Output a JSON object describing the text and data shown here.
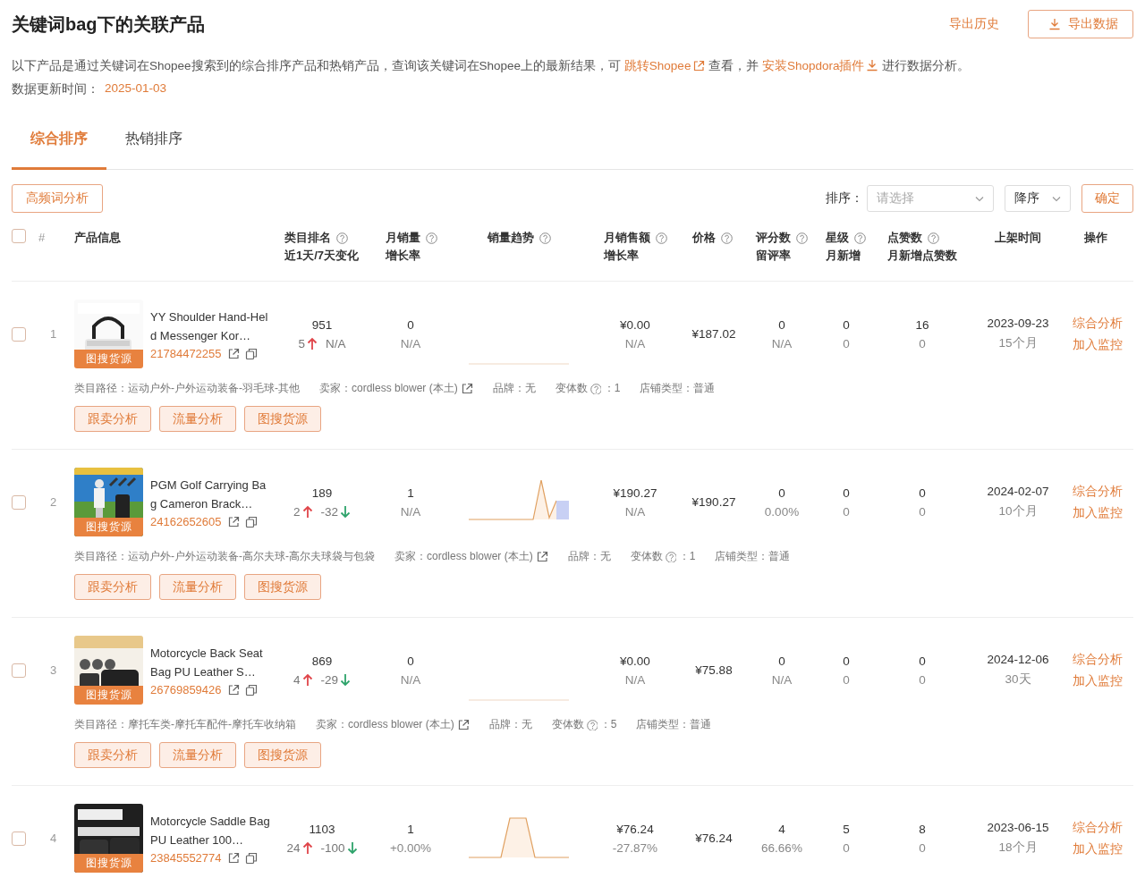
{
  "header": {
    "title": "关键词bag下的关联产品",
    "history_link": "导出历史",
    "export_button": "导出数据"
  },
  "intro": {
    "before": "以下产品是通过关键词在Shopee搜索到的综合排序产品和热销产品，查询该关键词在Shopee上的最新结果，可 ",
    "link_jump": "跳转Shopee",
    "middle": " 查看，并 ",
    "link_install": "安装Shopdora插件",
    "after": " 进行数据分析。"
  },
  "update": {
    "label": "数据更新时间：",
    "value": "2025-01-03"
  },
  "tabs": [
    {
      "label": "综合排序",
      "selected": true
    },
    {
      "label": "热销排序",
      "selected": false
    }
  ],
  "toolbar": {
    "keyword_button": "高频词分析",
    "sort_label": "排序：",
    "sort_field": {
      "placeholder": "请选择"
    },
    "order_field": {
      "value": "降序"
    },
    "confirm_button": "确定"
  },
  "table": {
    "select_all": {
      "checked": false
    },
    "columns": [
      {
        "title": "#",
        "help": false
      },
      {
        "title": "产品信息",
        "help": false
      },
      {
        "title": "类目排名",
        "subtitle": "近1天/7天变化",
        "help": true
      },
      {
        "title": "月销量",
        "subtitle": "增长率",
        "help": true
      },
      {
        "title": "销量趋势",
        "help": true
      },
      {
        "title": "月销售额",
        "subtitle": "增长率",
        "help": true
      },
      {
        "title": "价格",
        "help": true
      },
      {
        "title": "评分数",
        "subtitle": "留评率",
        "help": true
      },
      {
        "title": "星级",
        "subtitle": "月新增",
        "help": true
      },
      {
        "title": "点赞数",
        "subtitle": "月新增点赞数",
        "help": true
      },
      {
        "title": "上架时间",
        "help": false
      },
      {
        "title": "操作",
        "help": false
      }
    ],
    "rows": [
      {
        "checked": false,
        "index": "1",
        "image": {
          "kind": "picture"
        },
        "image_badge": "图搜货源",
        "title": "YY Shoulder Hand-Held Messenger Kor…",
        "product_id": "21784472255",
        "rank": "951",
        "rank_day": {
          "value": "5",
          "kind": "up"
        },
        "rank_week": {
          "value": "N/A",
          "kind": "none"
        },
        "monthly_sales": "0",
        "sales_growth": "N/A",
        "trend": {
          "kind": "flat"
        },
        "revenue": "¥0.00",
        "revenue_growth": "N/A",
        "price": "¥187.02",
        "reviews": "0",
        "review_rate": "N/A",
        "star_level": "0",
        "star_new": "0",
        "likes": "16",
        "likes_new": "0",
        "listed": "2023-09-23",
        "age": "15个月",
        "actions": [
          "综合分析",
          "加入监控"
        ],
        "meta": {
          "category": "类目路径：运动户外-户外运动装备-羽毛球-其他",
          "seller": "卖家：cordless blower (本土)",
          "brand": "品牌：无",
          "variants_label": "变体数",
          "variants_value": "：1",
          "shop_type": "店铺类型：普通"
        },
        "buttons": [
          "跟卖分析",
          "流量分析",
          "图搜货源"
        ]
      },
      {
        "checked": false,
        "index": "2",
        "image": {
          "kind": "picture"
        },
        "image_badge": "图搜货源",
        "title": "PGM Golf Carrying Bag Cameron Brack…",
        "product_id": "24162652605",
        "rank": "189",
        "rank_day": {
          "value": "2",
          "kind": "up"
        },
        "rank_week": {
          "value": "-32",
          "kind": "down"
        },
        "monthly_sales": "1",
        "sales_growth": "N/A",
        "trend": {
          "kind": "spike"
        },
        "revenue": "¥190.27",
        "revenue_growth": "N/A",
        "price": "¥190.27",
        "reviews": "0",
        "review_rate": "0.00%",
        "star_level": "0",
        "star_new": "0",
        "likes": "0",
        "likes_new": "0",
        "listed": "2024-02-07",
        "age": "10个月",
        "actions": [
          "综合分析",
          "加入监控"
        ],
        "meta": {
          "category": "类目路径：运动户外-户外运动装备-高尔夫球-高尔夫球袋与包袋",
          "seller": "卖家：cordless blower (本土)",
          "brand": "品牌：无",
          "variants_label": "变体数",
          "variants_value": "：1",
          "shop_type": "店铺类型：普通"
        },
        "buttons": [
          "跟卖分析",
          "流量分析",
          "图搜货源"
        ]
      },
      {
        "checked": false,
        "index": "3",
        "image": {
          "kind": "picture"
        },
        "image_badge": "图搜货源",
        "title": "Motorcycle Back Seat Bag PU Leather S…",
        "product_id": "26769859426",
        "rank": "869",
        "rank_day": {
          "value": "4",
          "kind": "up"
        },
        "rank_week": {
          "value": "-29",
          "kind": "down"
        },
        "monthly_sales": "0",
        "sales_growth": "N/A",
        "trend": {
          "kind": "flat"
        },
        "revenue": "¥0.00",
        "revenue_growth": "N/A",
        "price": "¥75.88",
        "reviews": "0",
        "review_rate": "N/A",
        "star_level": "0",
        "star_new": "0",
        "likes": "0",
        "likes_new": "0",
        "listed": "2024-12-06",
        "age": "30天",
        "actions": [
          "综合分析",
          "加入监控"
        ],
        "meta": {
          "category": "类目路径：摩托车类-摩托车配件-摩托车收纳箱",
          "seller": "卖家：cordless blower (本土)",
          "brand": "品牌：无",
          "variants_label": "变体数",
          "variants_value": "：5",
          "shop_type": "店铺类型：普通"
        },
        "buttons": [
          "跟卖分析",
          "流量分析",
          "图搜货源"
        ]
      },
      {
        "checked": false,
        "index": "4",
        "image": {
          "kind": "picture"
        },
        "image_badge": "图搜货源",
        "title": "Motorcycle Saddle Bag PU Leather 100…",
        "product_id": "23845552774",
        "rank": "1103",
        "rank_day": {
          "value": "24",
          "kind": "up"
        },
        "rank_week": {
          "value": "-100",
          "kind": "down"
        },
        "monthly_sales": "1",
        "sales_growth": "+0.00%",
        "trend": {
          "kind": "plateau"
        },
        "revenue": "¥76.24",
        "revenue_growth": "-27.87%",
        "price": "¥76.24",
        "reviews": "4",
        "review_rate": "66.66%",
        "star_level": "5",
        "star_new": "0",
        "likes": "8",
        "likes_new": "0",
        "listed": "2023-06-15",
        "age": "18个月",
        "actions": [
          "综合分析",
          "加入监控"
        ]
      }
    ]
  }
}
